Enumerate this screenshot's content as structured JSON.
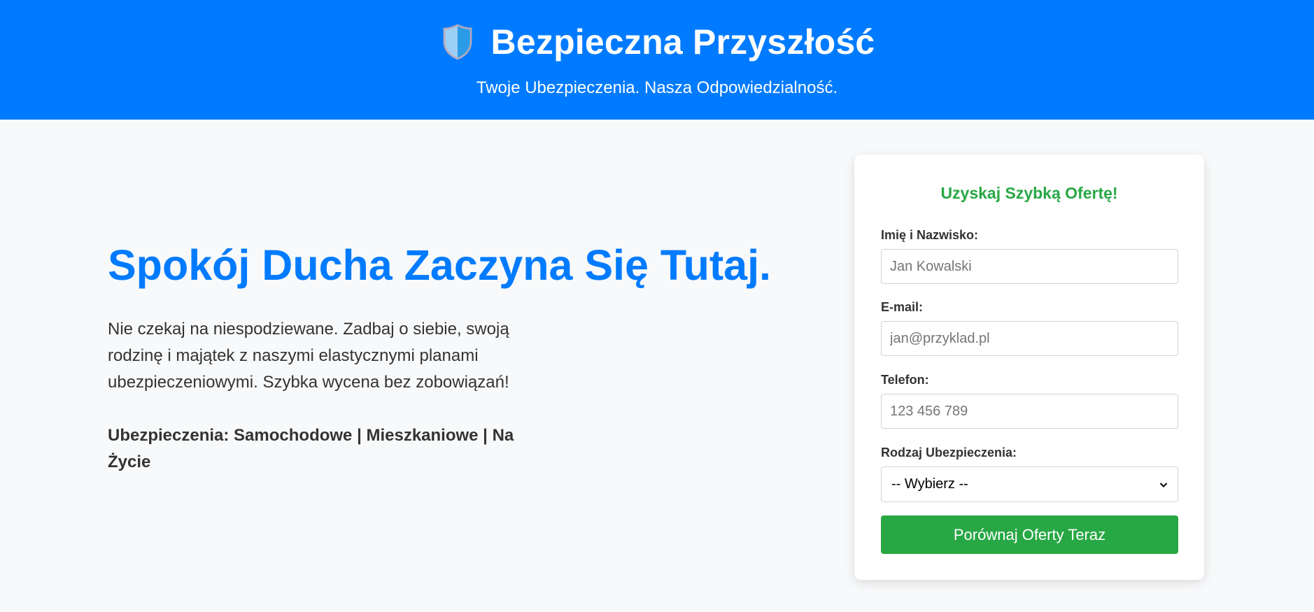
{
  "header": {
    "brand_icon": "shield-icon",
    "title": "Bezpieczna Przyszłość",
    "tagline": "Twoje Ubezpieczenia. Nasza Odpowiedzialność."
  },
  "hero": {
    "heading": "Spokój Ducha Zaczyna Się Tutaj.",
    "text": "Nie czekaj na niespodziewane. Zadbaj o siebie, swoją rodzinę i majątek z naszymi elastycznymi planami ubezpieczeniowymi. Szybka wycena bez zobowiązań!",
    "types": "Ubezpieczenia: Samochodowe | Mieszkaniowe | Na Życie"
  },
  "form": {
    "title": "Uzyskaj Szybką Ofertę!",
    "name_label": "Imię i Nazwisko:",
    "name_placeholder": "Jan Kowalski",
    "email_label": "E-mail:",
    "email_placeholder": "jan@przyklad.pl",
    "phone_label": "Telefon:",
    "phone_placeholder": "123 456 789",
    "type_label": "Rodzaj Ubezpieczenia:",
    "type_selected": "-- Wybierz --",
    "submit_label": "Porównaj Oferty Teraz"
  },
  "colors": {
    "primary": "#007bff",
    "accent": "#28a745",
    "background": "#f8f9fa",
    "text": "#333333"
  }
}
